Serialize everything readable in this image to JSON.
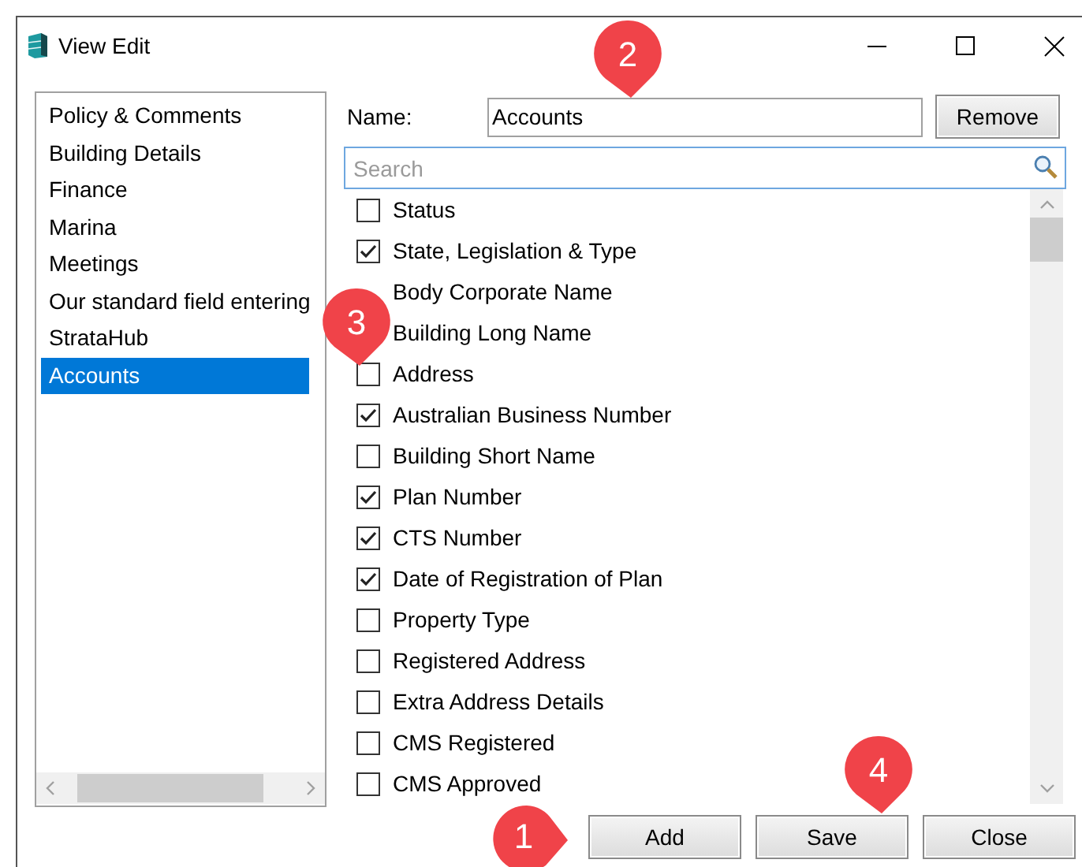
{
  "window": {
    "title": "View Edit"
  },
  "sidebar": {
    "items": [
      {
        "label": "Policy & Comments",
        "selected": false
      },
      {
        "label": "Building Details",
        "selected": false
      },
      {
        "label": "Finance",
        "selected": false
      },
      {
        "label": "Marina",
        "selected": false
      },
      {
        "label": "Meetings",
        "selected": false
      },
      {
        "label": "Our standard field entering",
        "selected": false
      },
      {
        "label": "StrataHub",
        "selected": false
      },
      {
        "label": "Accounts",
        "selected": true
      }
    ]
  },
  "name_field": {
    "label": "Name:",
    "value": "Accounts"
  },
  "remove_button": "Remove",
  "search": {
    "placeholder": "Search"
  },
  "fields": [
    {
      "label": "Status",
      "checked": false
    },
    {
      "label": "State, Legislation & Type",
      "checked": true
    },
    {
      "label": "Body Corporate Name"
    },
    {
      "label": "Building Long Name"
    },
    {
      "label": "Address",
      "checked": false
    },
    {
      "label": "Australian Business Number",
      "checked": true
    },
    {
      "label": "Building Short Name",
      "checked": false
    },
    {
      "label": "Plan Number",
      "checked": true
    },
    {
      "label": "CTS Number",
      "checked": true
    },
    {
      "label": "Date of Registration of Plan",
      "checked": true
    },
    {
      "label": "Property Type",
      "checked": false
    },
    {
      "label": "Registered Address",
      "checked": false
    },
    {
      "label": "Extra Address Details",
      "checked": false
    },
    {
      "label": "CMS Registered",
      "checked": false
    },
    {
      "label": "CMS Approved",
      "checked": false
    }
  ],
  "buttons": [
    "Add",
    "Save",
    "Close"
  ],
  "callouts": [
    {
      "number": "1"
    },
    {
      "number": "2"
    },
    {
      "number": "3"
    },
    {
      "number": "4"
    }
  ]
}
